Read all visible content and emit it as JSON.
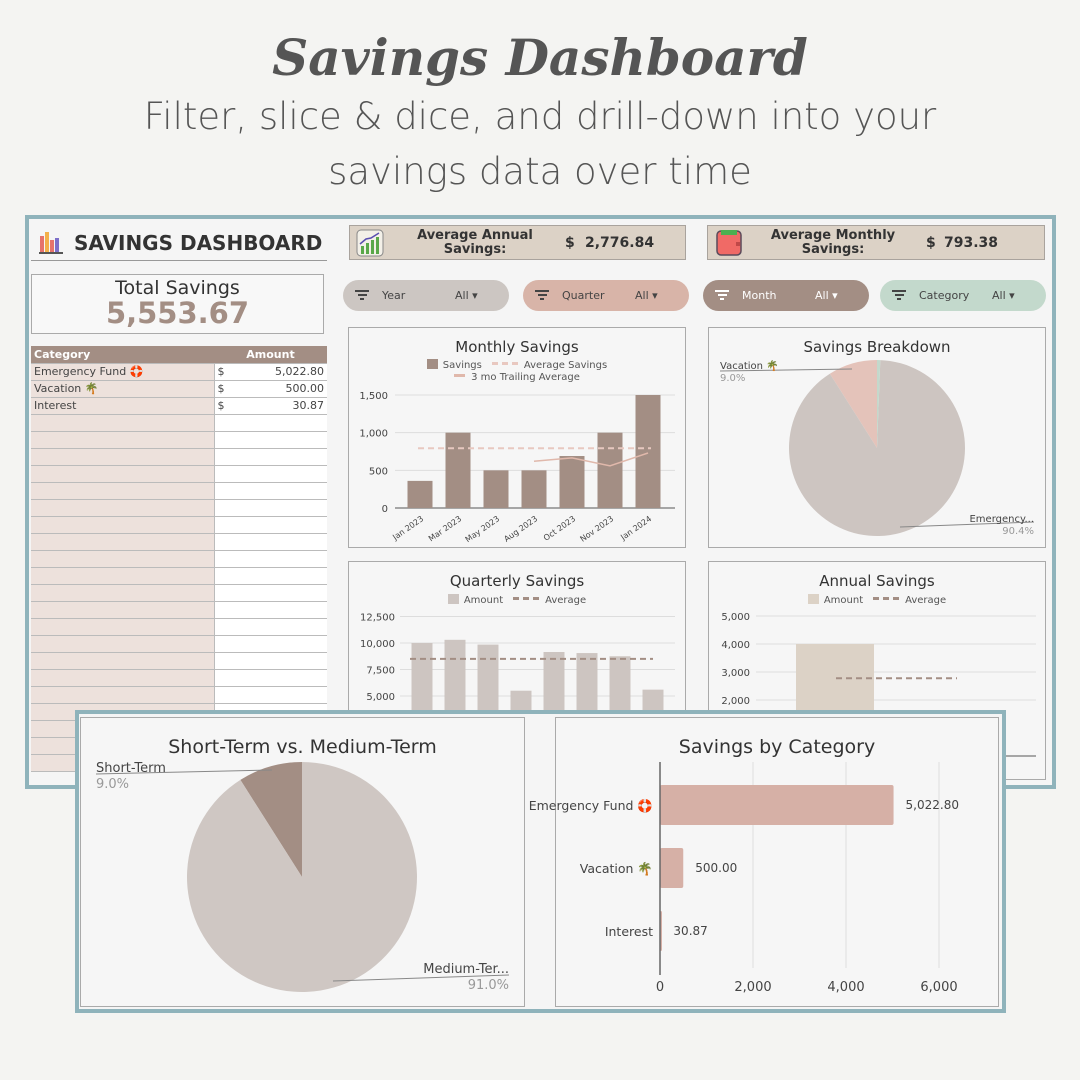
{
  "hero": {
    "title": "Savings Dashboard",
    "subtitle_line1": "Filter, slice & dice, and drill-down into your",
    "subtitle_line2": "savings data over time"
  },
  "header": {
    "title": "SAVINGS DASHBOARD",
    "icon": "bar-chart-icon"
  },
  "total": {
    "label": "Total Savings",
    "value": "5,553.67"
  },
  "kpis": [
    {
      "label": "Average Annual Savings:",
      "currency": "$",
      "value": "2,776.84",
      "icon": "growth-chart-icon"
    },
    {
      "label": "Average Monthly Savings:",
      "currency": "$",
      "value": "793.38",
      "icon": "wallet-icon"
    }
  ],
  "filters": [
    {
      "label": "Year",
      "value": "All",
      "color": "#ccc6c2"
    },
    {
      "label": "Quarter",
      "value": "All",
      "color": "#d8b4a8"
    },
    {
      "label": "Month",
      "value": "All",
      "color": "#a38e84"
    },
    {
      "label": "Category",
      "value": "All",
      "color": "#c3d9cc"
    }
  ],
  "table": {
    "headers": [
      "Category",
      "Amount"
    ],
    "rows": [
      {
        "category": "Emergency Fund 🛟",
        "currency": "$",
        "amount": "5,022.80"
      },
      {
        "category": "Vacation 🌴",
        "currency": "$",
        "amount": "500.00"
      },
      {
        "category": "Interest",
        "currency": "$",
        "amount": "30.87"
      }
    ]
  },
  "colors": {
    "frame": "#8fb3bb",
    "brown": "#a38e84",
    "pink": "#d8b4a8",
    "grey": "#cdc5c1",
    "green": "#c3d9cc",
    "beige": "#dcd2c6"
  },
  "chart_data": [
    {
      "id": "monthly",
      "type": "bar",
      "title": "Monthly Savings",
      "categories": [
        "Jan 2023",
        "Mar 2023",
        "May 2023",
        "Aug 2023",
        "Oct 2023",
        "Nov 2023",
        "Jan 2024"
      ],
      "series": [
        {
          "name": "Savings",
          "values": [
            360,
            1000,
            500,
            500,
            690,
            1000,
            1500
          ],
          "color": "#a38e84"
        },
        {
          "name": "Average Savings",
          "values": [
            793,
            793,
            793,
            793,
            793,
            793,
            793
          ],
          "style": "dashed",
          "color": "#e8c8c0"
        },
        {
          "name": "3 mo Trailing Average",
          "values": [
            null,
            null,
            null,
            620,
            665,
            560,
            730
          ],
          "color": "#e0b8ab"
        }
      ],
      "yticks": [
        "0",
        "500",
        "1,000",
        "1,500"
      ],
      "ylim": [
        0,
        1500
      ],
      "grid": true,
      "legend": "top"
    },
    {
      "id": "breakdown",
      "type": "pie",
      "title": "Savings Breakdown",
      "slices": [
        {
          "name": "Vacation 🌴",
          "pct_label": "9.0%",
          "value": 9.0,
          "color": "#e4c3ba"
        },
        {
          "name": "Emergency...",
          "pct_label": "90.4%",
          "value": 90.4,
          "color": "#cdc5c1"
        },
        {
          "name": "",
          "value": 0.6,
          "color": "#c3d9cc"
        }
      ]
    },
    {
      "id": "quarterly",
      "type": "bar",
      "title": "Quarterly Savings",
      "series": [
        {
          "name": "Amount",
          "values": [
            10000,
            10300,
            9850,
            5500,
            9150,
            9050,
            8750,
            5600
          ],
          "color": "#cdc5c1"
        },
        {
          "name": "Average",
          "value": 8500,
          "style": "dashed",
          "color": "#a38e84"
        }
      ],
      "yticks": [
        "5,000",
        "7,500",
        "10,000",
        "12,500"
      ],
      "grid": true,
      "legend": "top"
    },
    {
      "id": "annual",
      "type": "bar",
      "title": "Annual Savings",
      "series": [
        {
          "name": "Amount",
          "values": [
            4000
          ],
          "color": "#dcd2c6"
        },
        {
          "name": "Average",
          "value": 2777,
          "style": "dashed",
          "color": "#a38e84"
        }
      ],
      "yticks": [
        "2,000",
        "3,000",
        "4,000",
        "5,000"
      ],
      "grid": true,
      "legend": "top"
    },
    {
      "id": "term",
      "type": "pie",
      "title": "Short-Term vs. Medium-Term",
      "slices": [
        {
          "name": "Short-Term",
          "pct_label": "9.0%",
          "value": 9.0,
          "color": "#a38e84"
        },
        {
          "name": "Medium-Ter...",
          "pct_label": "91.0%",
          "value": 91.0,
          "color": "#cfc7c3"
        }
      ]
    },
    {
      "id": "by_category",
      "type": "bar",
      "orientation": "horizontal",
      "title": "Savings by Category",
      "categories": [
        "Emergency Fund 🛟",
        "Vacation 🌴",
        "Interest"
      ],
      "values": [
        5022.8,
        500.0,
        30.87
      ],
      "data_labels": [
        "5,022.80",
        "500.00",
        "30.87"
      ],
      "xticks": [
        "0",
        "2,000",
        "4,000",
        "6,000"
      ],
      "xlim": [
        0,
        6000
      ],
      "grid": true,
      "color": "#d6b0a6"
    }
  ]
}
